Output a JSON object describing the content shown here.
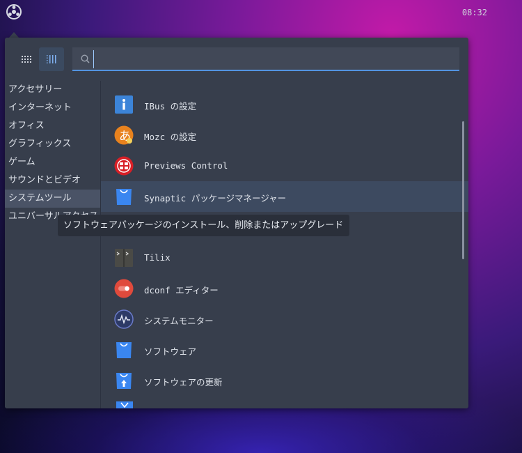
{
  "topbar": {
    "clock": "08:32"
  },
  "search": {
    "placeholder": "",
    "value": ""
  },
  "categories": [
    {
      "label": "アクセサリー"
    },
    {
      "label": "インターネット"
    },
    {
      "label": "オフィス"
    },
    {
      "label": "グラフィックス"
    },
    {
      "label": "ゲーム"
    },
    {
      "label": "サウンドとビデオ"
    },
    {
      "label": "システムツール",
      "active": true
    },
    {
      "label": "ユニバーサルアクセス"
    }
  ],
  "apps": [
    {
      "label": "IBus の設定",
      "icon": "ibus-icon"
    },
    {
      "label": "Mozc の設定",
      "icon": "mozc-icon"
    },
    {
      "label": "Previews Control",
      "icon": "previews-control-icon"
    },
    {
      "label": "Synaptic パッケージマネージャー",
      "icon": "synaptic-icon",
      "active": true
    },
    {
      "label": "",
      "icon": ""
    },
    {
      "label": "Tilix",
      "icon": "tilix-icon"
    },
    {
      "label": "dconf エディター",
      "icon": "dconf-icon"
    },
    {
      "label": "システムモニター",
      "icon": "system-monitor-icon"
    },
    {
      "label": "ソフトウェア",
      "icon": "software-icon"
    },
    {
      "label": "ソフトウェアの更新",
      "icon": "software-update-icon"
    }
  ],
  "tooltip": {
    "text": "ソフトウェアパッケージのインストール、削除またはアップグレード"
  },
  "colors": {
    "accent": "#5294e2",
    "panel": "#373e4c",
    "selected": "#3d4a60"
  }
}
